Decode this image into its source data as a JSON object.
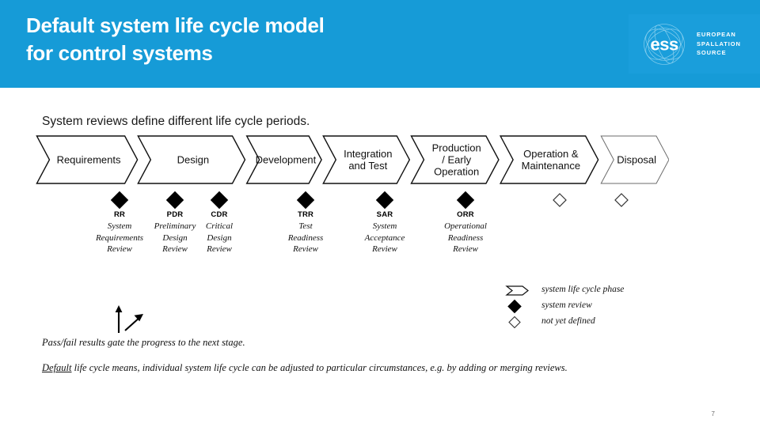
{
  "header": {
    "title_line1": "Default system life cycle model",
    "title_line2": "for control systems",
    "band_color": "#169BD7",
    "logo": {
      "mark": "ess-logo-icon",
      "line1": "EUROPEAN",
      "line2": "SPALLATION",
      "line3": "SOURCE"
    }
  },
  "body": {
    "lead_line": "System reviews define different life cycle periods."
  },
  "diagram": {
    "phases": [
      {
        "label": "Requirements",
        "lines": [
          "Requirements"
        ]
      },
      {
        "label": "Design",
        "lines": [
          "Design"
        ]
      },
      {
        "label": "Development",
        "lines": [
          "Development"
        ]
      },
      {
        "label": "Integration and Test",
        "lines": [
          "Integration",
          "and Test"
        ]
      },
      {
        "label": "Production / Early Operation",
        "lines": [
          "Production",
          "/ Early",
          "Operation"
        ]
      },
      {
        "label": "Operation & Maintenance",
        "lines": [
          "Operation &",
          "Maintenance"
        ]
      },
      {
        "label": "Disposal",
        "lines": [
          "Disposal"
        ]
      }
    ],
    "reviews": [
      {
        "abbr": "RR",
        "lines": [
          "System",
          "Requirements",
          "Review"
        ]
      },
      {
        "abbr": "PDR",
        "lines": [
          "Preliminary",
          "Design",
          "Review"
        ]
      },
      {
        "abbr": "CDR",
        "lines": [
          "Critical",
          "Design",
          "Review"
        ]
      },
      {
        "abbr": "TRR",
        "lines": [
          "Test",
          "Readiness",
          "Review"
        ]
      },
      {
        "abbr": "SAR",
        "lines": [
          "System",
          "Acceptance",
          "Review"
        ]
      },
      {
        "abbr": "ORR",
        "lines": [
          "Operational",
          "Readiness",
          "Review"
        ]
      }
    ],
    "undefined_reviews": 2
  },
  "legend": {
    "items": [
      {
        "icon": "phase-chevron-icon",
        "label": "system life cycle phase"
      },
      {
        "icon": "filled-diamond-icon",
        "label": "system review"
      },
      {
        "icon": "outline-diamond-icon",
        "label": "not yet defined"
      }
    ]
  },
  "notes": {
    "gate": "Pass/fail results gate the progress to the next stage.",
    "default_underlined": "Default",
    "default_rest": " life cycle means, individual system life cycle can be adjusted to particular circumstances, e.g. by adding or merging reviews."
  },
  "footer": {
    "page_number": "7"
  }
}
